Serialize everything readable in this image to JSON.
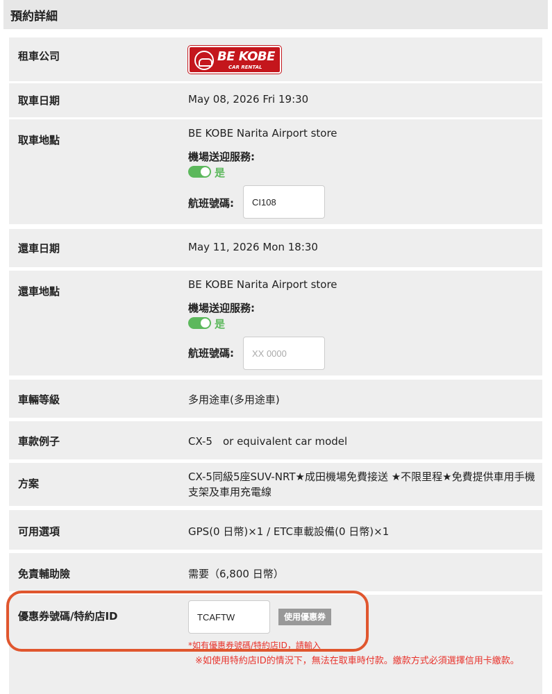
{
  "section_title": "預約詳細",
  "rental_company": {
    "label": "租車公司",
    "logo_text": "BE KOBE",
    "logo_subtext": "CAR RENTAL"
  },
  "pickup_date": {
    "label": "取車日期",
    "value": "May 08, 2026 Fri 19:30"
  },
  "pickup_location": {
    "label": "取車地點",
    "value": "BE KOBE Narita Airport store",
    "shuttle_label": "機場送迎服務:",
    "shuttle_value": "是",
    "flight_label": "航班號碼:",
    "flight_value": "CI108"
  },
  "return_date": {
    "label": "還車日期",
    "value": "May 11, 2026 Mon 18:30"
  },
  "return_location": {
    "label": "還車地點",
    "value": "BE KOBE Narita Airport store",
    "shuttle_label": "機場送迎服務:",
    "shuttle_value": "是",
    "flight_label": "航班號碼:",
    "flight_placeholder": "XX 0000"
  },
  "vehicle_class": {
    "label": "車輛等級",
    "value": "多用途車(多用途車)"
  },
  "car_model": {
    "label": "車款例子",
    "value": "CX-5　or equivalent car model"
  },
  "plan": {
    "label": "方案",
    "value": "CX-5同級5座SUV-NRT★成田機場免費接送 ★不限里程★免費提供車用手機支架及車用充電線"
  },
  "options": {
    "label": "可用選項",
    "value": "GPS(0 日幣)×1 / ETC車載設備(0 日幣)×1"
  },
  "insurance": {
    "label": "免責輔助險",
    "value": "需要（6,800 日幣）"
  },
  "coupon": {
    "label": "優惠券號碼/特約店ID",
    "value": "TCAFTW",
    "button_label": "使用優惠券",
    "note1": "*如有優惠券號碼/特約店ID，請輸入",
    "note2": "※如使用特約店ID的情況下，無法在取車時付款。繳款方式必須選擇信用卡繳款。"
  },
  "colors": {
    "accent_green": "#5cb85c",
    "brand_red": "#c4161c",
    "warning_red": "#e8322b",
    "highlight_orange": "#e0562e"
  }
}
